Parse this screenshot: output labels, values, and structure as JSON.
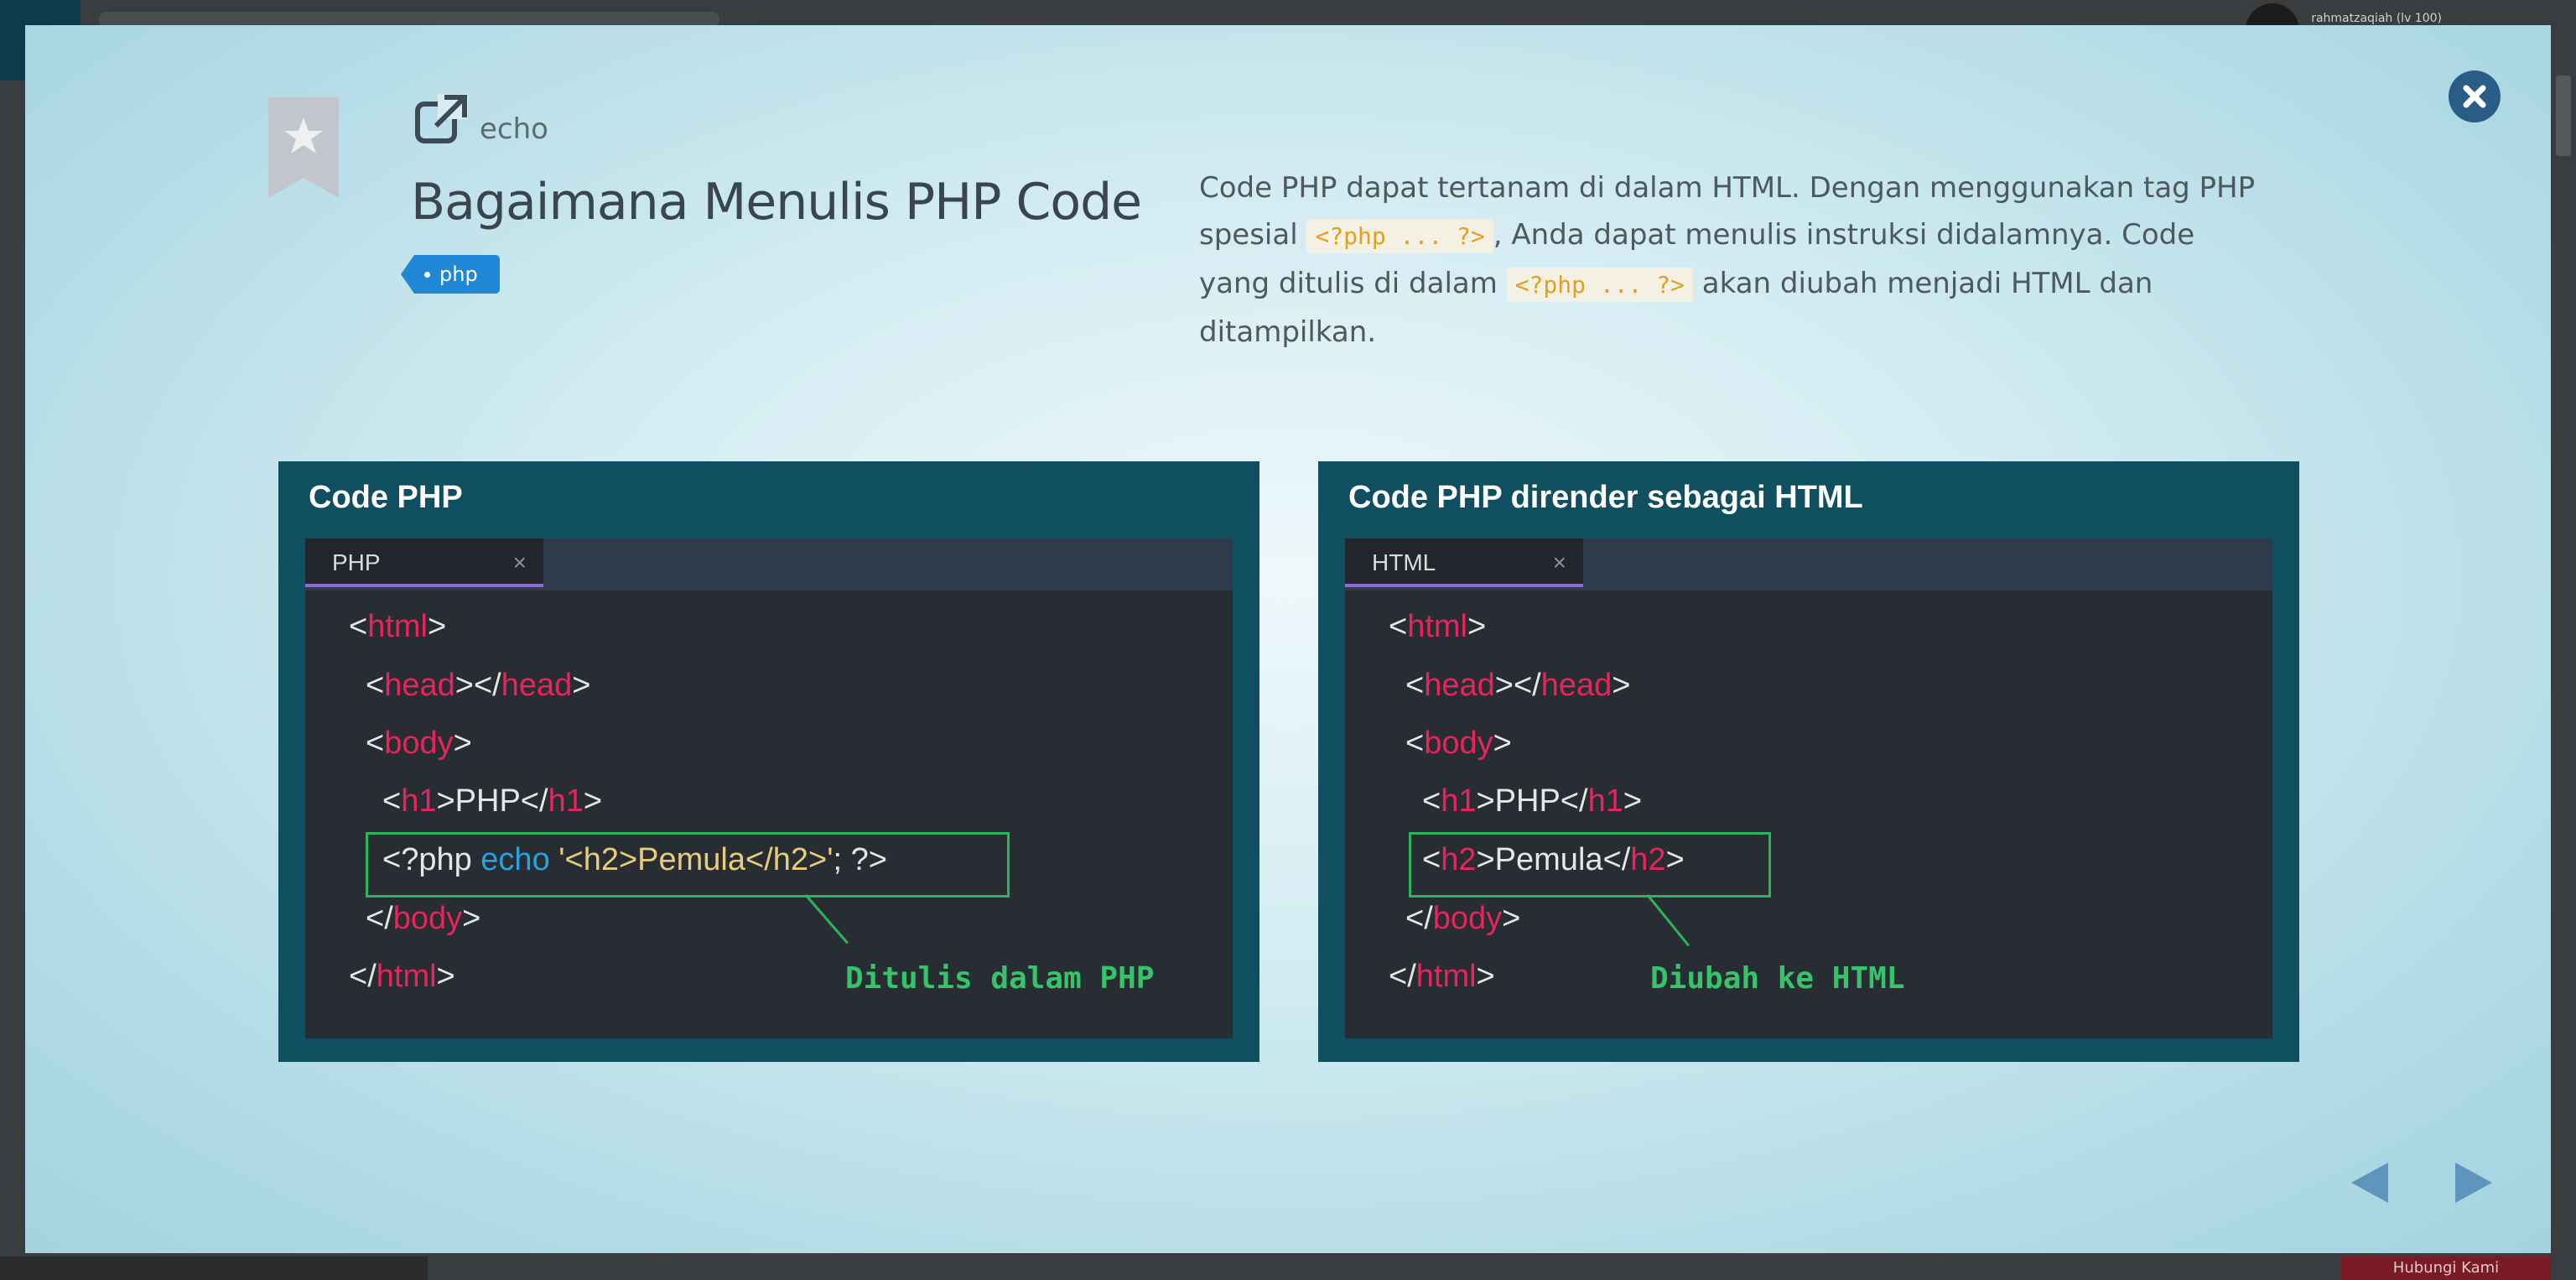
{
  "backdrop": {
    "user_name": "rahmatzaqiah (lv 100)",
    "cta_label": "Hubungi Kami"
  },
  "lesson": {
    "category": "echo",
    "title": "Bagaimana Menulis PHP Code",
    "tag": "php",
    "description": {
      "part1": "Code PHP dapat tertanam di dalam HTML. Dengan menggunakan tag PHP spesial ",
      "code1": "<?php ... ?>",
      "part2": ", Anda dapat menulis instruksi didalamnya. Code yang ditulis di dalam ",
      "code2": "<?php ... ?>",
      "part3": " akan diubah menjadi HTML dan ditampilkan."
    }
  },
  "panels": {
    "left": {
      "title": "Code PHP",
      "tab": "PHP",
      "tab_close": "×",
      "callout": "Ditulis dalam PHP",
      "lines": {
        "l1a": "<",
        "l1b": "html",
        "l1c": ">",
        "l2a": "<",
        "l2b": "head",
        "l2c": "></",
        "l2d": "head",
        "l2e": ">",
        "l3a": "<",
        "l3b": "body",
        "l3c": ">",
        "l4a": "<",
        "l4b": "h1",
        "l4c": ">PHP</",
        "l4d": "h1",
        "l4e": ">",
        "l5a": "<?php ",
        "l5b": "echo",
        "l5c": " '<h2>Pemula</h2>'",
        "l5d": "; ?>",
        "l6a": "</",
        "l6b": "body",
        "l6c": ">",
        "l7a": "</",
        "l7b": "html",
        "l7c": ">"
      }
    },
    "right": {
      "title": "Code PHP dirender sebagai HTML",
      "tab": "HTML",
      "tab_close": "×",
      "callout": "Diubah ke HTML",
      "lines": {
        "l1a": "<",
        "l1b": "html",
        "l1c": ">",
        "l2a": "<",
        "l2b": "head",
        "l2c": "></",
        "l2d": "head",
        "l2e": ">",
        "l3a": "<",
        "l3b": "body",
        "l3c": ">",
        "l4a": "<",
        "l4b": "h1",
        "l4c": ">PHP</",
        "l4d": "h1",
        "l4e": ">",
        "l5a": "<",
        "l5b": "h2",
        "l5c": ">Pemula</",
        "l5d": "h2",
        "l5e": ">",
        "l6a": "</",
        "l6b": "body",
        "l6c": ">",
        "l7a": "</",
        "l7b": "html",
        "l7c": ">"
      }
    }
  },
  "colors": {
    "tag_bg": "#1e88d6",
    "panel_bg": "#0f4f5f",
    "editor_bg": "#282c33",
    "code_tag": "#e8245a",
    "code_keyword": "#24a3e0",
    "code_string": "#e8cc7a",
    "callout": "#35c46a",
    "close_button": "#2a5d86"
  },
  "icons": {
    "close": "close-circle-icon",
    "bookmark": "bookmark-star-icon",
    "category": "external-link-icon",
    "prev": "triangle-left-icon",
    "next": "triangle-right-icon"
  }
}
